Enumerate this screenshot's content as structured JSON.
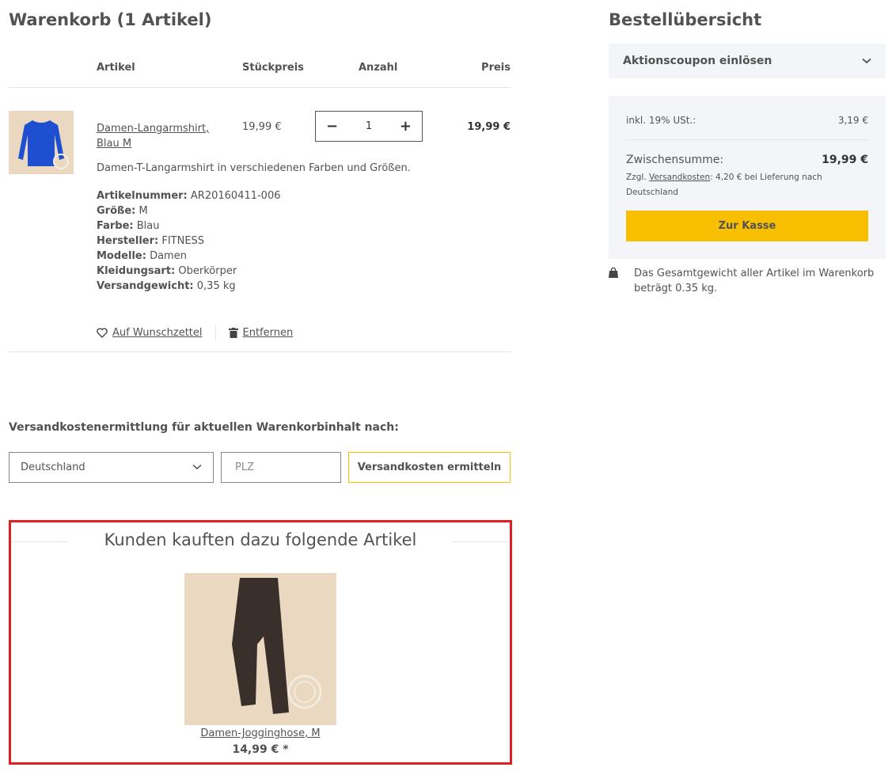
{
  "cart": {
    "title": "Warenkorb (1 Artikel)",
    "columns": {
      "article": "Artikel",
      "unit_price": "Stückpreis",
      "quantity": "Anzahl",
      "price": "Preis"
    },
    "item": {
      "name": "Damen-Langarmshirt, Blau M",
      "unit_price": "19,99 €",
      "quantity": "1",
      "price": "19,99 €",
      "description": "Damen-T-Langarmshirt in verschiedenen Farben und Größen.",
      "properties": [
        {
          "label": "Artikelnummer:",
          "value": "AR20160411-006"
        },
        {
          "label": "Größe:",
          "value": "M"
        },
        {
          "label": "Farbe:",
          "value": "Blau"
        },
        {
          "label": "Hersteller:",
          "value": "FITNESS"
        },
        {
          "label": "Modelle:",
          "value": "Damen"
        },
        {
          "label": "Kleidungsart:",
          "value": "Oberkörper"
        },
        {
          "label": "Versandgewicht:",
          "value": "0,35 kg"
        }
      ],
      "wishlist_label": "Auf Wunschzettel",
      "remove_label": "Entfernen",
      "image_color": "#1e4fd0"
    }
  },
  "shipping": {
    "title": "Versandkostenermittlung für aktuellen Warenkorbinhalt nach:",
    "country": "Deutschland",
    "zip_placeholder": "PLZ",
    "button_label": "Versandkosten ermitteln"
  },
  "recommendations": {
    "title": "Kunden kauften dazu folgende Artikel",
    "product": {
      "name": "Damen-Jogginghose, M",
      "price": "14,99 € *"
    }
  },
  "summary": {
    "title": "Bestellübersicht",
    "coupon_label": "Aktionscoupon einlösen",
    "vat_label": "inkl. 19% USt.:",
    "vat_value": "3,19 €",
    "subtotal_label": "Zwischensumme:",
    "subtotal_value": "19,99 €",
    "shipping_prefix": "Zzgl.",
    "shipping_link": "Versandkosten",
    "shipping_suffix": ": 4,20 € bei Lieferung nach Deutschland",
    "checkout_label": "Zur Kasse",
    "weight_note": "Das Gesamtgewicht aller Artikel im Warenkorb beträgt 0.35 kg."
  },
  "colors": {
    "accent": "#f7bf00",
    "highlight_border": "#e02020",
    "panel_bg": "#f4f5f8"
  }
}
